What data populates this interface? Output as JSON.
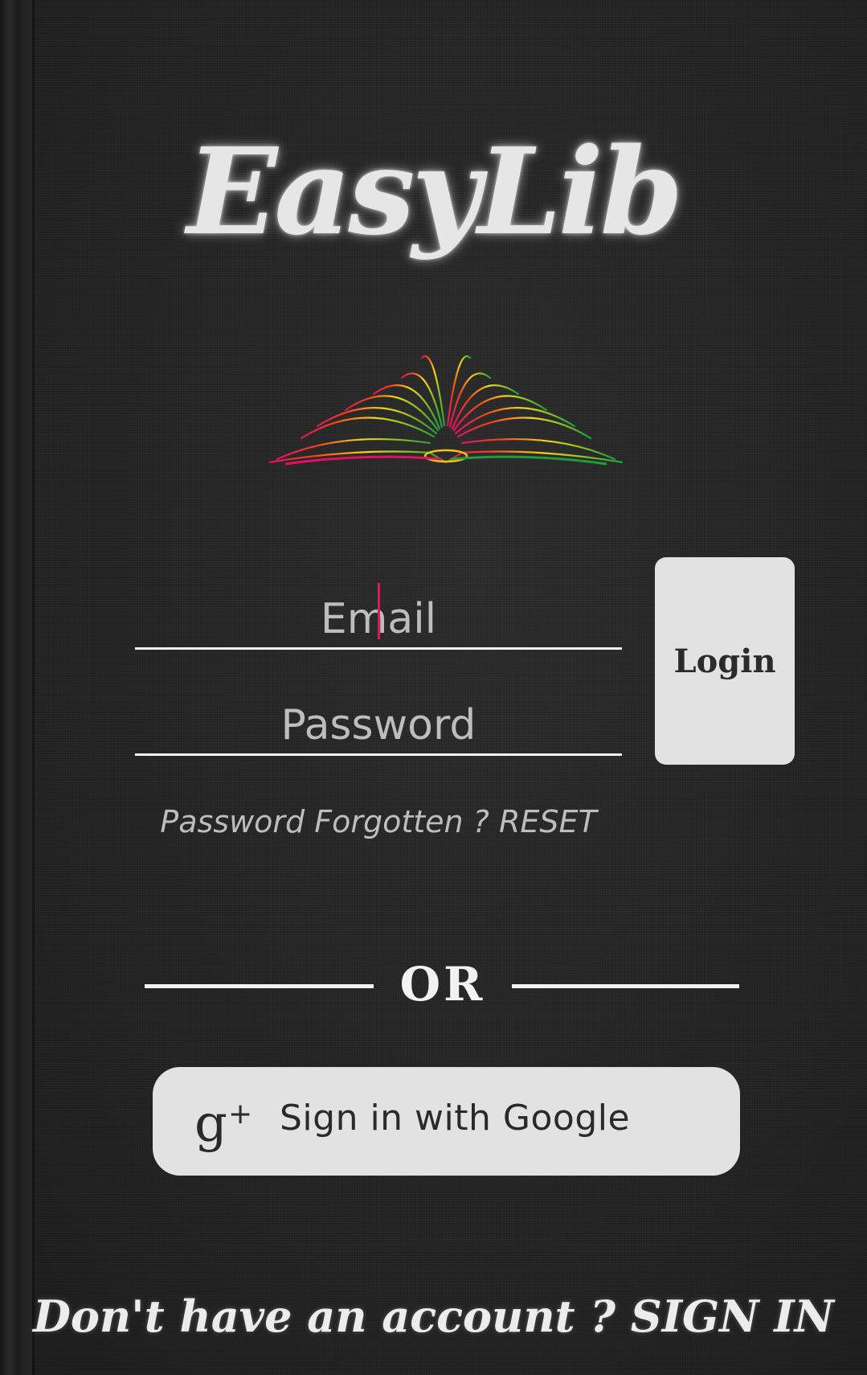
{
  "app": {
    "logo_text": "EasyLib"
  },
  "login_form": {
    "email_placeholder": "Email",
    "password_placeholder": "Password",
    "login_button_label": "Login",
    "forgot_password_prefix": "Password Forgotten ? ",
    "reset_link_label": "RESET"
  },
  "divider": {
    "label": "OR"
  },
  "google_signin": {
    "label": "Sign in with Google",
    "icon": "google-plus-icon"
  },
  "signup_row": {
    "prefix": "Don't have an account ? ",
    "signin_link_label": "SIGN IN"
  },
  "colors": {
    "background": "#262626",
    "accent_cursor": "#d81b60",
    "button_bg": "#e2e2e2",
    "text_light": "#f2f2f2"
  }
}
